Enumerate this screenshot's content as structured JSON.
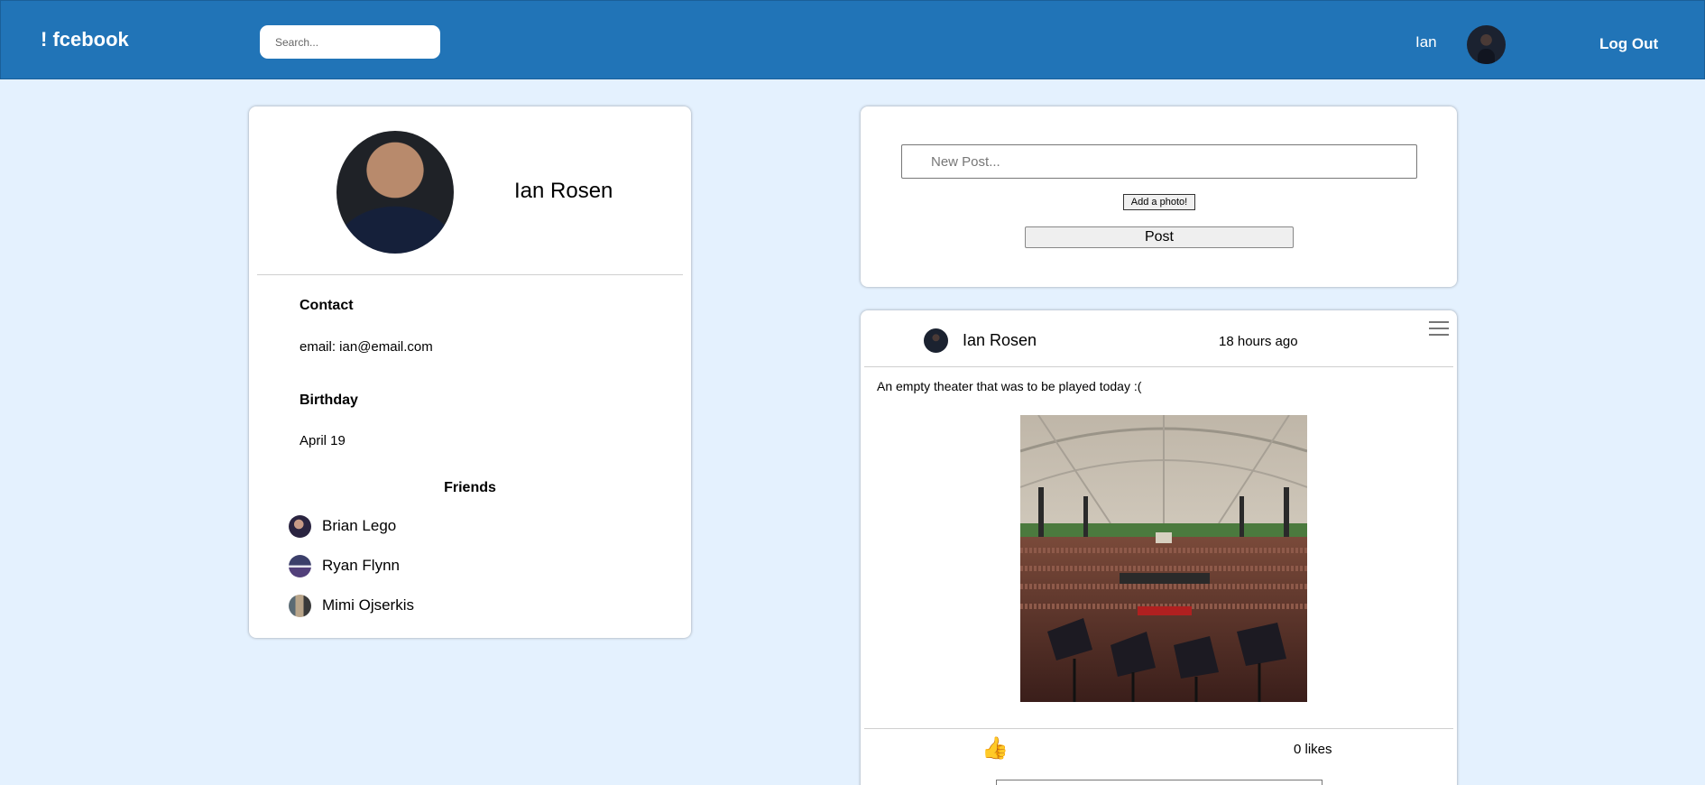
{
  "header": {
    "logo": "! fcebook",
    "search_placeholder": "Search...",
    "user_name": "Ian",
    "logout_label": "Log Out",
    "bg_color": "#2174b7"
  },
  "profile": {
    "name": "Ian Rosen",
    "contact_label": "Contact",
    "email": "email: ian@email.com",
    "birthday_label": "Birthday",
    "birthday": "April 19",
    "friends_label": "Friends",
    "friends": [
      {
        "name": "Brian Lego"
      },
      {
        "name": "Ryan Flynn"
      },
      {
        "name": "Mimi Ojserkis"
      }
    ]
  },
  "composer": {
    "placeholder": "New Post...",
    "add_photo_label": "Add a photo!",
    "post_label": "Post"
  },
  "post": {
    "author": "Ian Rosen",
    "time": "18 hours ago",
    "text": "An empty theater that was to be played today :(",
    "like_icon": "👍",
    "likes": "0 likes"
  },
  "colors": {
    "page_bg": "#e4f1fe",
    "accent": "#2174b7"
  }
}
